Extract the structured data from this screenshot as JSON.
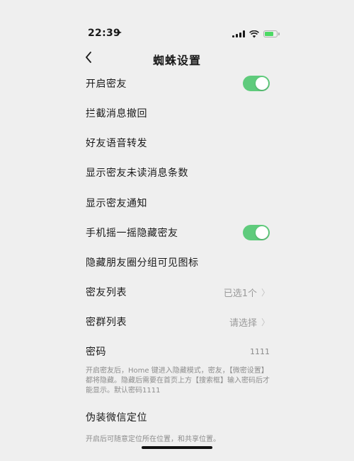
{
  "status": {
    "time": "22:39",
    "location_icon": "location-arrow-icon",
    "battery_color": "#4cd964"
  },
  "nav": {
    "title": "蜘蛛设置",
    "back_icon": "chevron-left-icon"
  },
  "settings": {
    "enable_secret_friend": "开启密友",
    "intercept_recall": "拦截消息撤回",
    "voice_forward": "好友语音转发",
    "show_unread_count": "显示密友未读消息条数",
    "show_notification": "显示密友通知",
    "shake_hide": "手机摇一摇隐藏密友",
    "hide_moments_icon": "隐藏朋友圈分组可见图标",
    "friend_list_label": "密友列表",
    "friend_list_value": "已选1个",
    "group_list_label": "密群列表",
    "group_list_value": "请选择",
    "password_label": "密码",
    "password_value": "1111"
  },
  "toggles": {
    "enable_secret_friend_on": true,
    "shake_hide_on": true,
    "on_color": "#5fcb7c"
  },
  "descriptions": {
    "password_hint": "开启密友后，Home 键进入隐藏模式，密友，【微密设置】都将隐藏。隐藏后需要在首页上方【搜索框】输入密码后才能显示。默认密码1111",
    "fake_location_title": "伪装微信定位",
    "fake_location_hint": "开启后可随意定位所在位置，和共享位置。"
  }
}
